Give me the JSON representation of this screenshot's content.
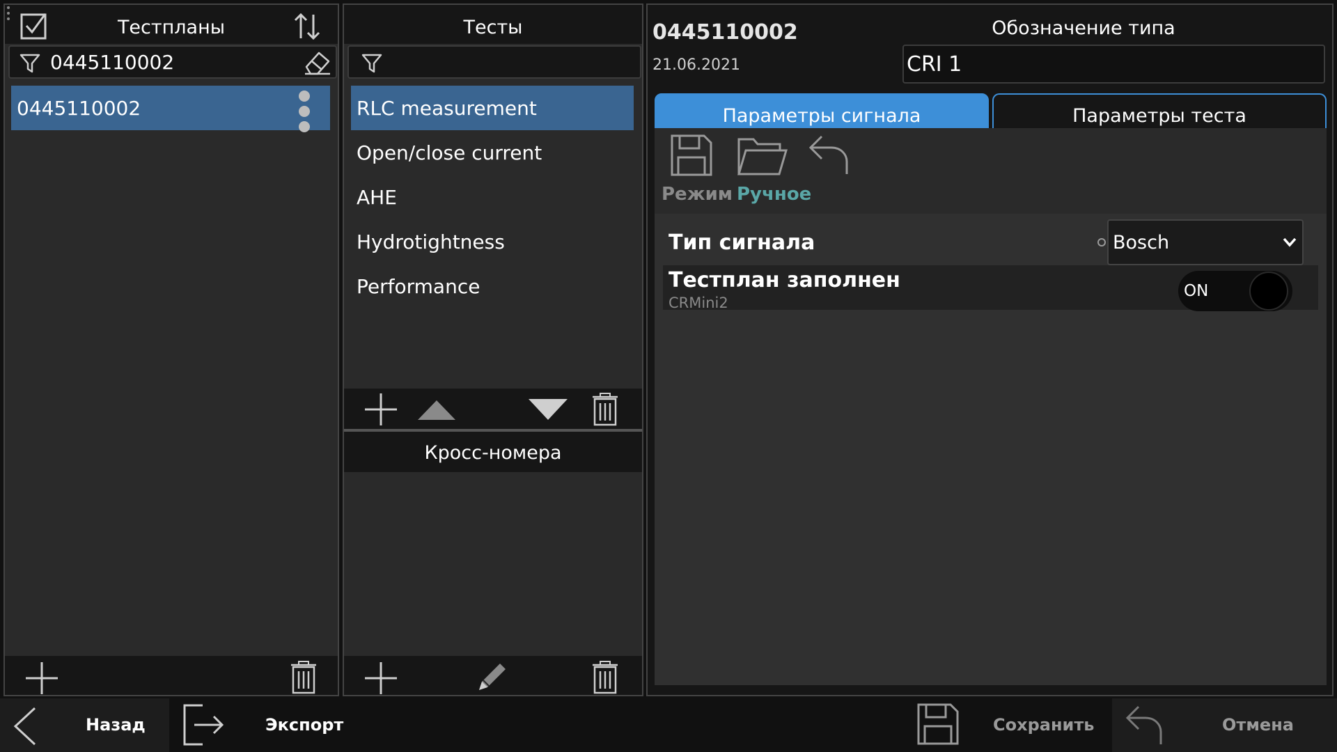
{
  "testplans": {
    "title": "Тестпланы",
    "filter_value": "0445110002",
    "items": [
      {
        "label": "0445110002",
        "selected": true
      }
    ]
  },
  "tests": {
    "title": "Тесты",
    "filter_value": "",
    "items": [
      {
        "label": "RLC measurement",
        "selected": true
      },
      {
        "label": "Open/close current",
        "selected": false
      },
      {
        "label": "AHE",
        "selected": false
      },
      {
        "label": "Hydrotightness",
        "selected": false
      },
      {
        "label": "Performance",
        "selected": false
      }
    ],
    "cross_title": "Кросс-номера"
  },
  "detail": {
    "number": "0445110002",
    "date": "21.06.2021",
    "type_label": "Обозначение типа",
    "type_value": "CRI 1",
    "tabs": [
      {
        "label": "Параметры сигнала",
        "active": true
      },
      {
        "label": "Параметры теста",
        "active": false
      }
    ],
    "mode_label": "Режим",
    "mode_value": "Ручное",
    "signal_type_label": "Тип сигнала",
    "signal_type_value": "Bosch",
    "filled_label": "Тестплан заполнен",
    "filled_sub": "CRMini2",
    "toggle_text": "ON"
  },
  "bottom": {
    "back": "Назад",
    "export": "Экспорт",
    "save": "Сохранить",
    "cancel": "Отмена"
  },
  "colors": {
    "selection": "#3a6591",
    "tab_active": "#3d8fd8",
    "mode_value": "#5aa7a7"
  }
}
